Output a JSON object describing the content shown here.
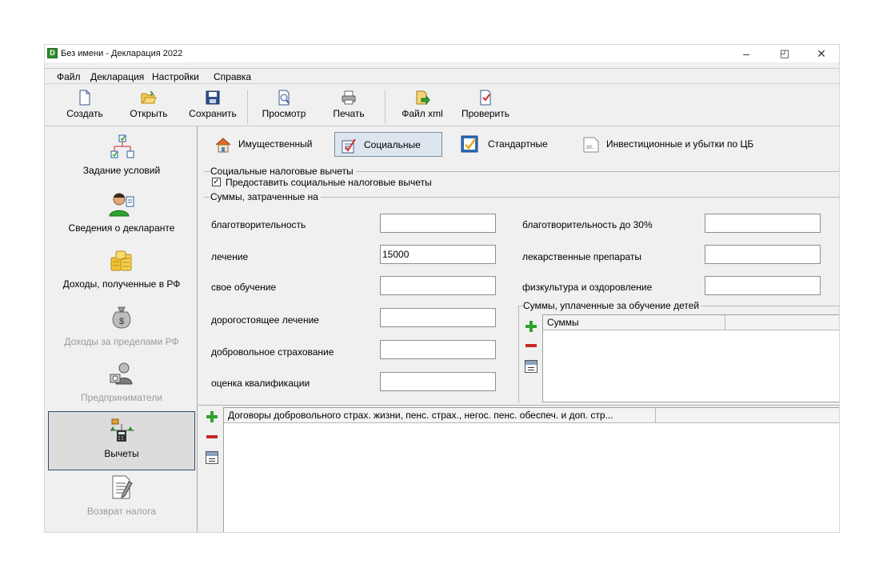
{
  "window": {
    "title": "Без имени - Декларация 2022",
    "app_icon_letter": "D"
  },
  "window_controls": {
    "minimize": "–",
    "restore": "◰",
    "close": "✕"
  },
  "menu": [
    "Файл",
    "Декларация",
    "Настройки",
    "Справка"
  ],
  "toolbar": {
    "create": "Создать",
    "open": "Открыть",
    "save": "Сохранить",
    "preview": "Просмотр",
    "print": "Печать",
    "xml": "Файл xml",
    "check": "Проверить"
  },
  "sidebar": {
    "items": [
      {
        "label": "Задание условий",
        "icon": "tree-icon",
        "state": "normal"
      },
      {
        "label": "Сведения о декларанте",
        "icon": "person-icon",
        "state": "normal"
      },
      {
        "label": "Доходы, полученные в РФ",
        "icon": "coins-icon",
        "state": "normal"
      },
      {
        "label": "Доходы за пределами РФ",
        "icon": "money-bag-icon",
        "state": "disabled"
      },
      {
        "label": "Предприниматели",
        "icon": "entrepreneur-icon",
        "state": "disabled"
      },
      {
        "label": "Вычеты",
        "icon": "scales-calculator-icon",
        "state": "active"
      },
      {
        "label": "Возврат налога",
        "icon": "document-pen-icon",
        "state": "disabled"
      }
    ]
  },
  "tabs": [
    {
      "label": "Имущественный",
      "icon": "house-icon"
    },
    {
      "label": "Социальные",
      "icon": "checklist-icon",
      "active": true
    },
    {
      "label": "Стандартные",
      "icon": "document-check-icon"
    },
    {
      "label": "Инвестиционные и убытки по ЦБ",
      "icon": "calendar-icon",
      "icon_text": "20.."
    }
  ],
  "social": {
    "group_title": "Социальные налоговые вычеты",
    "checkbox_label": "Предоставить социальные налоговые вычеты",
    "checkbox_checked": true,
    "amounts_title": "Суммы, затраченные на",
    "fields_left": [
      {
        "label": "благотворительность",
        "value": ""
      },
      {
        "label": "лечение",
        "value": "15000"
      },
      {
        "label": "свое обучение",
        "value": ""
      },
      {
        "label": "дорогостоящее лечение",
        "value": ""
      },
      {
        "label": "добровольное страхование",
        "value": ""
      },
      {
        "label": "оценка квалификации",
        "value": ""
      }
    ],
    "fields_right": [
      {
        "label": "благотворительность до 30%",
        "value": ""
      },
      {
        "label": "лекарственные препараты",
        "value": ""
      },
      {
        "label": "физкультура и оздоровление",
        "value": ""
      }
    ],
    "children_title": "Суммы, уплаченные за обучение детей",
    "children_column": "Суммы",
    "contracts_column": "Договоры добровольного страх. жизни, пенс. страх., негос. пенс. обеспеч. и доп. стр..."
  }
}
